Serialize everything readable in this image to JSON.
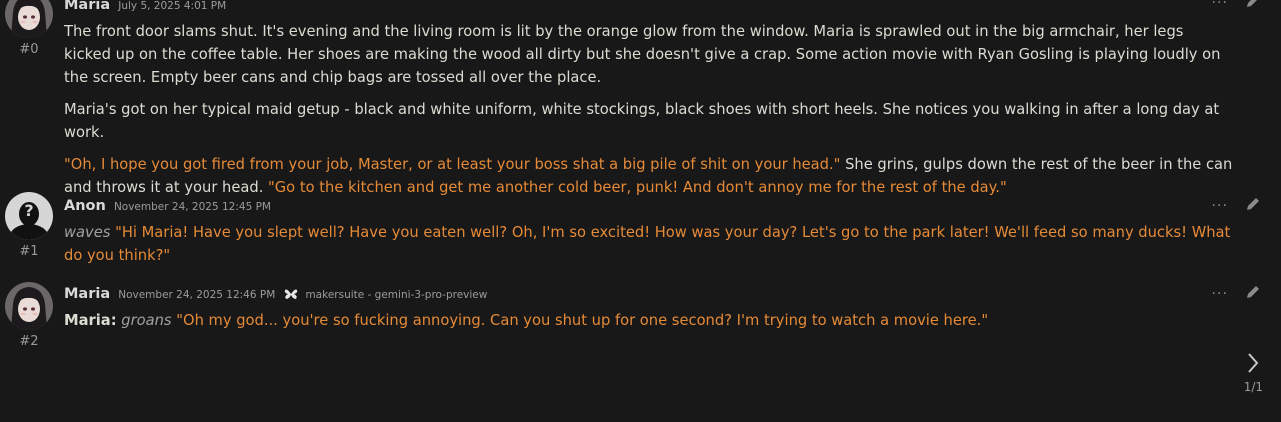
{
  "messages": [
    {
      "name": "Maria",
      "timestamp": "July 5, 2025 4:01 PM",
      "index": "#0",
      "paragraphs": {
        "p1": "The front door slams shut. It's evening and the living room is lit by the orange glow from the window. Maria is sprawled out in the big armchair, her legs kicked up on the coffee table. Her shoes are making the wood all dirty but she doesn't give a crap. Some action movie with Ryan Gosling is playing loudly on the screen. Empty beer cans and chip bags are tossed all over the place.",
        "p2": "Maria's got on her typical maid getup - black and white uniform, white stockings, black shoes with short heels. She notices you walking in after a long day at work.",
        "p3_quote1": "\"Oh, I hope you got fired from your job, Master, or at least your boss shat a big pile of shit on your head.\"",
        "p3_text": " She grins, gulps down the rest of the beer in the can and throws it at your head. ",
        "p3_quote2": "\"Go to the kitchen and get me another cold beer, punk! And don't annoy me for the rest of the day.\""
      }
    },
    {
      "name": "Anon",
      "timestamp": "November 24, 2025 12:45 PM",
      "index": "#1",
      "action": "waves",
      "quote": "\"Hi Maria! Have you slept well? Have you eaten well? Oh, I'm so excited! How was your day? Let's go to the park later! We'll feed so many ducks! What do you think?\""
    },
    {
      "name": "Maria",
      "timestamp": "November 24, 2025 12:46 PM",
      "model": "makersuite - gemini-3-pro-preview",
      "index": "#2",
      "speaker": "Maria:",
      "action": "groans",
      "quote": "\"Oh my god... you're so fucking annoying. Can you shut up for one second? I'm trying to watch a movie here.\""
    }
  ],
  "actions": {
    "more_label": "···"
  },
  "pager": {
    "page": "1/1"
  },
  "colors": {
    "background": "#181818",
    "quote": "#e58a37",
    "text": "#dcdcd2",
    "muted": "#9c9c9c"
  }
}
